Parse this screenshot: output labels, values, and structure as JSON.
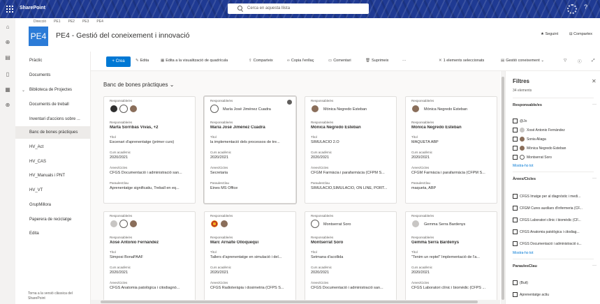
{
  "suite": {
    "brand": "SharePoint",
    "search_placeholder": "Cerca en aquesta llista",
    "help_label": "?"
  },
  "site": {
    "logo_text": "PE4",
    "title": "PE4 - Gestió del coneixement i innovació",
    "top_links": [
      "Direcció",
      "PE1",
      "PE2",
      "PE3",
      "PE4"
    ],
    "follow_label": "★ Seguint",
    "share_label": "⊟ Compartex"
  },
  "nav": {
    "items": [
      {
        "label": "Pràctic"
      },
      {
        "label": "Documents"
      },
      {
        "label": "Biblioteca de Projectes"
      },
      {
        "label": "Documents de treball"
      },
      {
        "label": "Inventari d'accions sobre ..."
      },
      {
        "label": "Banc de bones pràctiques"
      },
      {
        "label": "HV_Act"
      },
      {
        "label": "HV_CAS"
      },
      {
        "label": "HV_Manuals i PNT"
      },
      {
        "label": "HV_VT"
      },
      {
        "label": "GrupMillora"
      },
      {
        "label": "Paperera de reciclatge"
      },
      {
        "label": "Edita"
      }
    ],
    "footer": "Torna a la versió clàssica del SharePoint"
  },
  "commandbar": {
    "new_label": "+ Crea",
    "edit": "Edita",
    "grid_edit": "Edita a la visualització de quadrícula",
    "share": "Comparteix",
    "copy_link": "Copia l'enllaç",
    "comment": "Comentari",
    "delete": "Suprimeix",
    "more": "···",
    "selected": "1 elements seleccionats",
    "view": "Gestió coneixement",
    "view_chevron": "⌄"
  },
  "gallery": {
    "title": "Banc de bones pràctiques",
    "labels": {
      "responsable": "Responsable/es",
      "title": "Títol",
      "year": "Curs acadèmic",
      "areas": "Àrees/Cicles",
      "keywords": "ParaulesClau"
    },
    "cards": [
      {
        "avatar_name": "",
        "name": "Marta Sorribas Vivas, +2",
        "title": "Escenari d'aprenentatge (primer curs)",
        "year": "2020/2021",
        "areas": "CFGS Documentació i administració san...",
        "keywords": "Aprenentatge significatiu, Treball en eq..."
      },
      {
        "avatar_name": "María José Jiménez Cuadra",
        "name": "María José Jiménez Cuadra",
        "title": "la implementació dels processos de tre...",
        "year": "2020/2021",
        "areas": "Secretaria",
        "keywords": "Eines MS Office"
      },
      {
        "avatar_name": "Mónica Negredo Esteban",
        "name": "Mónica Negredo Esteban",
        "title": "SIMULACIÓ 2.O",
        "year": "2020/2021",
        "areas": "CFGM Farmàcia i parafarmàcia (CFPM S...",
        "keywords": "SIMULACIÓ,SIMULACIÓ, ON LINE, PORT..."
      },
      {
        "avatar_name": "Mónica Negredo Esteban",
        "name": "Mónica Negredo Esteban",
        "title": "MAQUETA ABP",
        "year": "2020/2021",
        "areas": "CFGM Farmàcia i parafarmàcia (CFPM S...",
        "keywords": "maqueta, ABP"
      },
      {
        "avatar_name": "",
        "name": "Xosé Antonio Fernández",
        "title": "Simposi BonaPAAF",
        "year": "2020/2021",
        "areas": "CFGS Anatomia patològica i citodiagnò...",
        "keywords": ""
      },
      {
        "avatar_name": "",
        "name": "Marc Arnalte Olloquequi",
        "title": "Tallers d'aprenentatge en simulació i del...",
        "year": "2020/2021",
        "areas": "CFGS Radioteràpia i dosimetria (CFPS S...",
        "keywords": ""
      },
      {
        "avatar_name": "Montserrat Soro",
        "name": "Montserrat Soro",
        "title": "Setmana d'acollida",
        "year": "2020/2021",
        "areas": "CFGS Documentació i administració san...",
        "keywords": ""
      },
      {
        "avatar_name": "Gemma Serra Bardenys",
        "name": "Gemma Serra Bardenys",
        "title": "\"Tenim un reptel\" Implementació de l'a...",
        "year": "2020/2021",
        "areas": "CFGS Laboratori clínic i biomèdic (CFPS ...",
        "keywords": ""
      }
    ]
  },
  "filters": {
    "title": "Filtres",
    "count": "34 elements",
    "close": "✕",
    "sections": {
      "responsables": {
        "label": "Responsable/es",
        "items": [
          "@Jo",
          "Xosé Antonio Fernández",
          "Sonia Aliaga",
          "Mónica Negredo Esteban",
          "Montserrat Soro"
        ],
        "more": "Mostra-ho tot"
      },
      "areas": {
        "label": "Àrees/Cicles",
        "items": [
          "CFGS Imatge per al diagnòstic i medi...",
          "CFGM Cures auxiliars d'infermeria (CF...",
          "CFGS Laboratori clínic i biomèdic (CF...",
          "CFGS Anatomia patològica i citodiag...",
          "CFGS Documentació i administració s..."
        ],
        "more": "Mostra-ho tot"
      },
      "keywords": {
        "label": "ParaulesClau",
        "items": [
          "(Buit)",
          "Aprenentatge actiu"
        ]
      }
    }
  }
}
